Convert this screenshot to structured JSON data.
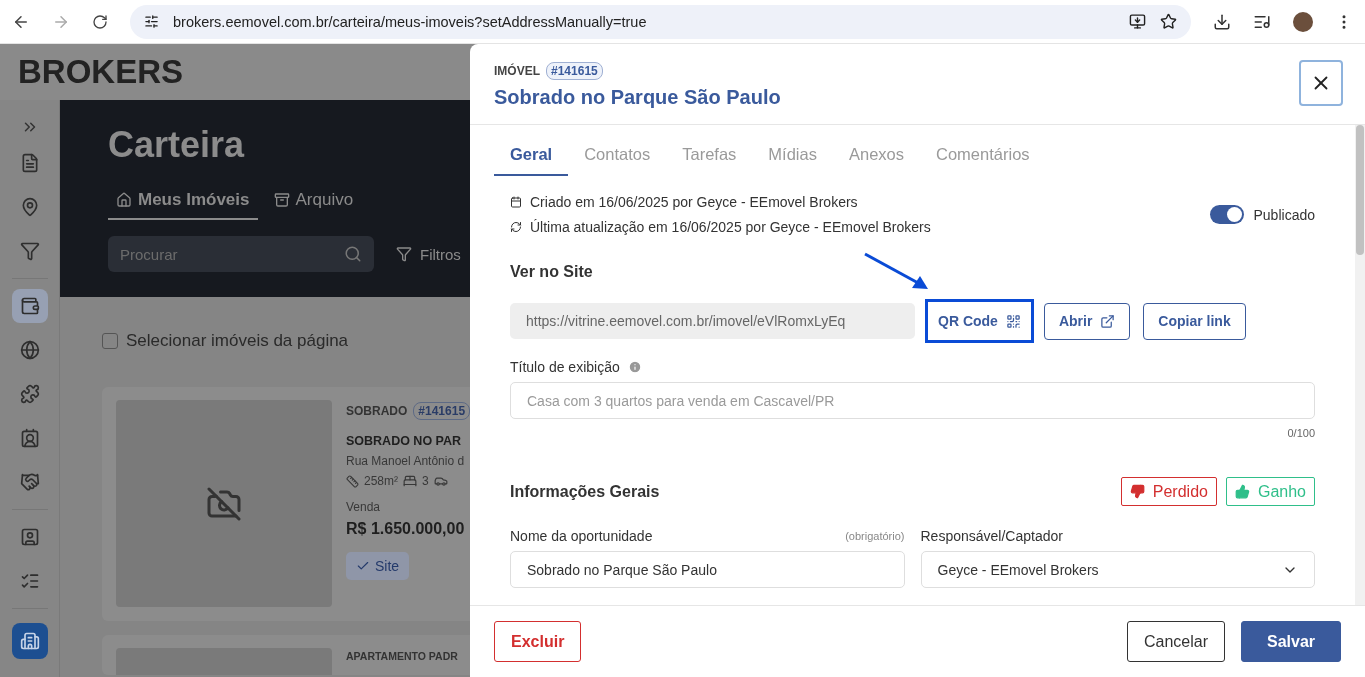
{
  "browser": {
    "url": "brokers.eemovel.com.br/carteira/meus-imoveis?setAddressManually=true"
  },
  "app": {
    "logo": "BROKERS",
    "sidebar": [
      {
        "selected": false
      },
      {
        "selected": false
      },
      {
        "selected": false
      },
      {
        "selected": true
      },
      {
        "selected": false
      },
      {
        "selected": false
      },
      {
        "selected": false
      },
      {
        "selected": false
      },
      {
        "selected": false
      },
      {
        "selected": false
      }
    ],
    "page_title": "Carteira",
    "tabs": [
      {
        "label": "Meus Imóveis",
        "selected": true
      },
      {
        "label": "Arquivo",
        "selected": false
      }
    ],
    "search": {
      "placeholder": "Procurar"
    },
    "filters": "Filtros",
    "select_all": {
      "label": "Selecionar imóveis da página",
      "checked": false
    },
    "cards": [
      {
        "type": "SOBRADO",
        "id": "#141615",
        "title": "SOBRADO NO PAR",
        "address": "Rua Manoel Antônio d",
        "area": "258m²",
        "bedrooms": "3",
        "sale_label": "Venda",
        "price": "R$ 1.650.000,00",
        "site": "Site"
      },
      {
        "type": "APARTAMENTO PADR"
      }
    ]
  },
  "drawer": {
    "label": "IMÓVEL",
    "id_badge": "#141615",
    "title": "Sobrado no Parque São Paulo",
    "tabs": [
      {
        "label": "Geral",
        "selected": true
      },
      {
        "label": "Contatos",
        "selected": false
      },
      {
        "label": "Tarefas",
        "selected": false
      },
      {
        "label": "Mídias",
        "selected": false
      },
      {
        "label": "Anexos",
        "selected": false
      },
      {
        "label": "Comentários",
        "selected": false
      }
    ],
    "meta": [
      {
        "kind": "created",
        "text": "Criado em 16/06/2025 por Geyce - EEmovel Brokers"
      },
      {
        "kind": "updated",
        "text": "Última atualização em 16/06/2025 por Geyce - EEmovel Brokers"
      }
    ],
    "published": {
      "label": "Publicado",
      "on": true
    },
    "site": {
      "heading": "Ver no Site",
      "url": "https://vitrine.eemovel.com.br/imovel/eVlRomxLyEq",
      "buttons": [
        {
          "label": "QR Code",
          "kind": "qr",
          "highlighted": true
        },
        {
          "label": "Abrir",
          "kind": "open",
          "highlighted": false
        },
        {
          "label": "Copiar link",
          "kind": "copy",
          "highlighted": false
        }
      ]
    },
    "display_title": {
      "label": "Título de exibição",
      "placeholder": "Casa com 3 quartos para venda em Cascavel/PR",
      "counter": "0/100"
    },
    "general": {
      "heading": "Informações Gerais",
      "status_buttons": [
        {
          "label": "Perdido",
          "kind": "lost"
        },
        {
          "label": "Ganho",
          "kind": "won"
        }
      ],
      "fields": [
        {
          "kind": "text",
          "label": "Nome da oportunidade",
          "hint": "(obrigatório)",
          "value": "Sobrado no Parque São Paulo"
        },
        {
          "kind": "select",
          "label": "Responsável/Captador",
          "value": "Geyce - EEmovel Brokers"
        }
      ]
    },
    "footer": {
      "delete": "Excluir",
      "cancel": "Cancelar",
      "save": "Salvar"
    }
  }
}
